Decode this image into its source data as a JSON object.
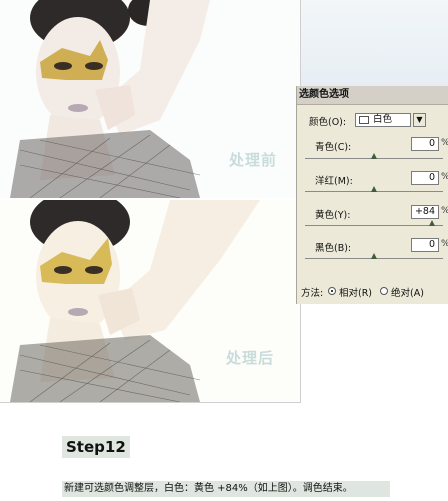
{
  "photos": {
    "before_label": "处理前",
    "after_label": "处理后"
  },
  "dialog": {
    "title": "选颜色选项",
    "colors_label": "颜色(O):",
    "colors_value": "白色",
    "sliders": [
      {
        "label": "青色(C):",
        "value": "0",
        "unit": "%",
        "level_percent": 0
      },
      {
        "label": "洋红(M):",
        "value": "0",
        "unit": "%",
        "level_percent": 0
      },
      {
        "label": "黄色(Y):",
        "value": "+84",
        "unit": "%",
        "level_percent": 84
      },
      {
        "label": "黑色(B):",
        "value": "0",
        "unit": "%",
        "level_percent": 0
      }
    ],
    "method_label": "方法:",
    "method_options": [
      {
        "label": "相对(R)",
        "selected": true
      },
      {
        "label": "绝对(A)",
        "selected": false
      }
    ]
  },
  "step": {
    "title": "Step12",
    "caption": "新建可选颜色调整层，白色：黄色 +84%（如上图）。调色结束。"
  },
  "colors": {
    "dialog_bg": "#ece9d8",
    "caption_bg": "#dfe6df",
    "watermark": "#c9dcdc"
  }
}
